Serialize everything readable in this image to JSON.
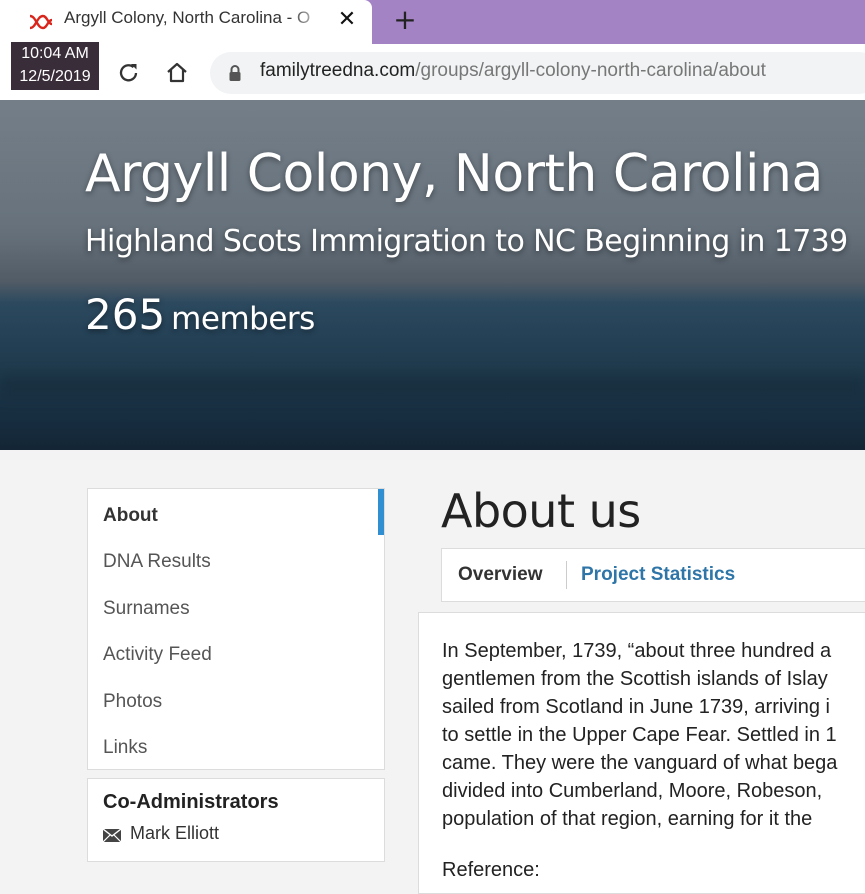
{
  "browser": {
    "tab_title": "Argyll Colony, North Carolina - O",
    "tab_close": "✕",
    "new_tab": "+",
    "clock_time": "10:04 AM",
    "clock_date": "12/5/2019",
    "url_host": "familytreedna.com",
    "url_path": "/groups/argyll-colony-north-carolina/about",
    "icons": [
      "dna-favicon-icon",
      "close-icon",
      "plus-icon",
      "reload-icon",
      "home-icon",
      "lock-icon"
    ]
  },
  "hero": {
    "title": "Argyll Colony, North Carolina",
    "subtitle": "Highland Scots Immigration to NC Beginning in 1739",
    "member_count": "265",
    "member_label": "members"
  },
  "sidebar": {
    "items": [
      {
        "label": "About",
        "active": true
      },
      {
        "label": "DNA Results",
        "active": false
      },
      {
        "label": "Surnames",
        "active": false
      },
      {
        "label": "Activity Feed",
        "active": false
      },
      {
        "label": "Photos",
        "active": false
      },
      {
        "label": "Links",
        "active": false
      }
    ],
    "accent_color": "#2f8fd0",
    "coadmin_title": "Co-Administrators",
    "coadmin_name": "Mark Elliott"
  },
  "main": {
    "title": "About us",
    "tabs": [
      {
        "label": "Overview",
        "active": true
      },
      {
        "label": "Project Statistics",
        "active": false
      }
    ],
    "paragraph_lines": [
      "In September, 1739, “about three hundred a",
      "gentlemen from the Scottish islands of Islay",
      "sailed from Scotland in June 1739, arriving i",
      "to settle in the Upper Cape Fear. Settled in 1",
      "came. They were the vanguard of what bega",
      "divided into Cumberland, Moore, Robeson,",
      "population of that region, earning for it the"
    ],
    "reference_label": "Reference:"
  },
  "colors": {
    "tabstrip": "#a383c4",
    "link_blue": "#2f76a8"
  }
}
